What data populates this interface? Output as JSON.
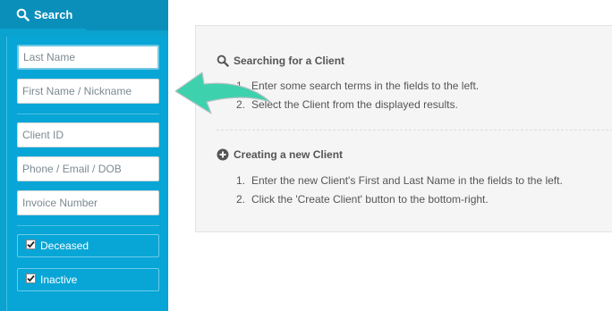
{
  "sidebar": {
    "tab_label": "Search",
    "fields": {
      "last_name_placeholder": "Last Name",
      "first_name_placeholder": "First Name / Nickname",
      "client_id_placeholder": "Client ID",
      "contact_placeholder": "Phone / Email / DOB",
      "invoice_placeholder": "Invoice Number"
    },
    "checkboxes": {
      "deceased_label": "Deceased",
      "deceased_checked": true,
      "inactive_label": "Inactive",
      "inactive_checked": true
    }
  },
  "info": {
    "search_section": {
      "title": "Searching for a Client",
      "steps": [
        {
          "num": "1.",
          "text": "Enter some search terms in the fields to the left."
        },
        {
          "num": "2.",
          "text": "Select the Client from the displayed results."
        }
      ]
    },
    "create_section": {
      "title": "Creating a new Client",
      "steps": [
        {
          "num": "1.",
          "text": "Enter the new Client's First and Last Name in the fields to the left."
        },
        {
          "num": "2.",
          "text": "Click the 'Create Client' button to the bottom-right."
        }
      ]
    }
  },
  "colors": {
    "sidebar_bg": "#0aa2cf",
    "header_bg": "#0a8fbb",
    "arrow_color": "#3dd1ad"
  }
}
